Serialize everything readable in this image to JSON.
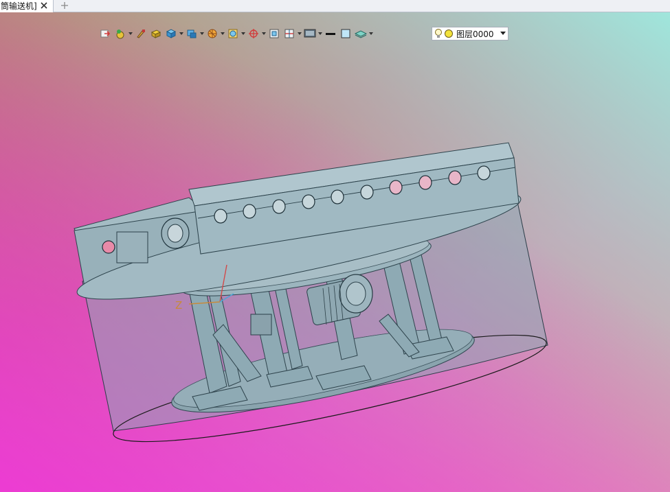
{
  "tabs": {
    "active_label": "筒输送机]",
    "close_icon": "close-icon",
    "add_icon": "plus-icon"
  },
  "toolbar": {
    "icons": [
      "exit-sketch-icon",
      "color-picker-icon",
      "paint-brush-icon",
      "solid-shading-icon",
      "box-view-icon",
      "view-orientation-icon",
      "section-view-icon",
      "zoom-view-icon",
      "coordinate-axis-icon",
      "frame-view-icon",
      "split-view-icon",
      "display-style-icon",
      "line-color-icon",
      "fill-color-icon",
      "layer-stack-icon"
    ]
  },
  "layer": {
    "value": "图层0000",
    "visible_icon": "bulb-icon",
    "state_icon": "status-circle-icon"
  },
  "viewport": {
    "axis_label": "Z"
  }
}
